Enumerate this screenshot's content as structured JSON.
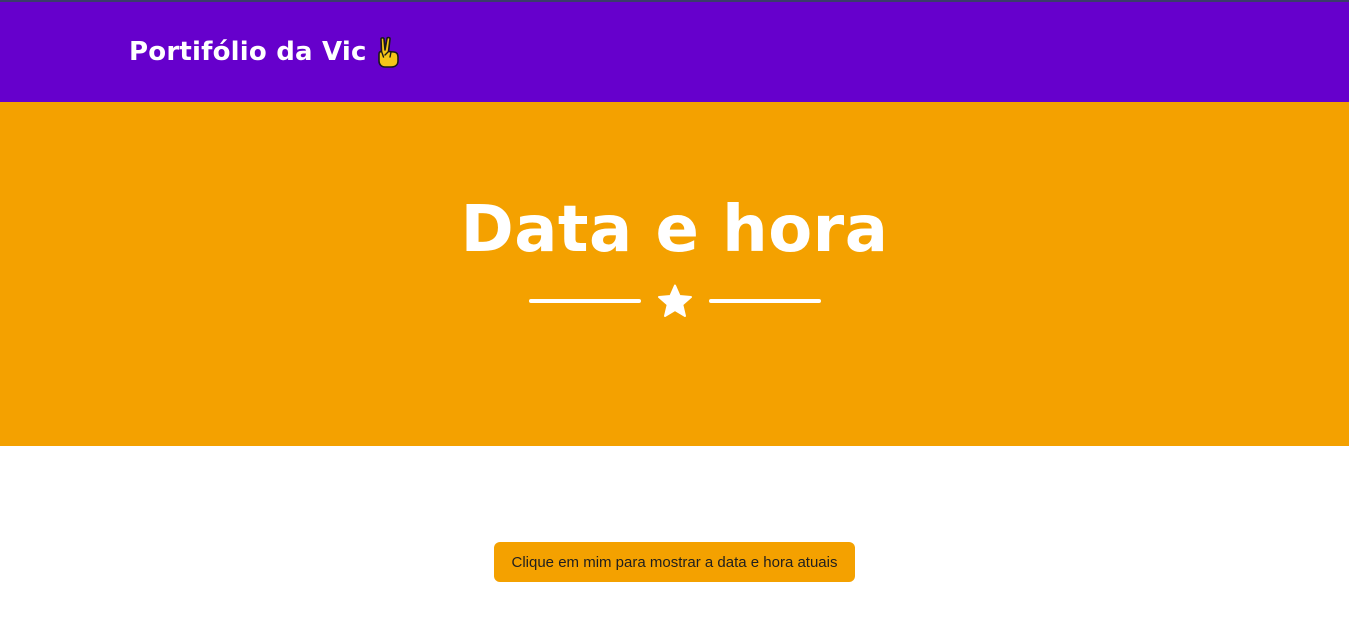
{
  "navbar": {
    "brand_text": "Portifólio da Vic",
    "brand_icon": "victory-hand-icon",
    "color": "#6600cc"
  },
  "masthead": {
    "title": "Data e hora",
    "divider_icon": "star-icon",
    "color": "#f4a100"
  },
  "content": {
    "button_label": "Clique em mim para mostrar a data e hora atuais",
    "button_color": "#f4a100"
  }
}
